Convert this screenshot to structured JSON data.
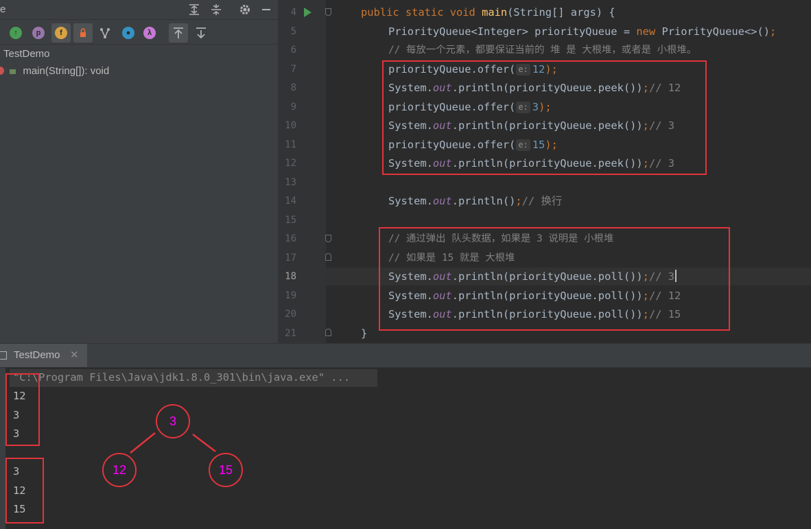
{
  "structure": {
    "title": "e",
    "header_icons": [
      "expand-all-icon",
      "collapse-all-icon",
      "gear-icon",
      "minimize-icon"
    ],
    "toolbar_icons": [
      "show-inherited-icon",
      "show-properties-icon",
      "show-fields-icon",
      "show-non-public-icon",
      "show-hierarchy-icon",
      "show-anonymous-icon",
      "show-lambdas-icon",
      "autoscroll-to-source-icon",
      "autoscroll-from-source-icon"
    ],
    "toolbar_labels": [
      "p",
      "f",
      "λ"
    ],
    "tree": {
      "class_name": "TestDemo",
      "method": "main(String[]): void"
    }
  },
  "editor": {
    "line_numbers": [
      "4",
      "5",
      "6",
      "7",
      "8",
      "9",
      "10",
      "11",
      "12",
      "13",
      "14",
      "15",
      "16",
      "17",
      "18",
      "19",
      "20",
      "21"
    ],
    "current_line": "18",
    "code": {
      "l4_kw": "public static void ",
      "l4_fn": "main",
      "l4_rest": "(String[] args) {",
      "l5_a": "PriorityQueue<Integer> priorityQueue = ",
      "l5_kw": "new ",
      "l5_b": "PriorityQueue<>()",
      "l5_semi": ";",
      "l6": "// 每放一个元素，都要保证当前的 堆 是 大根堆，或者是 小根堆。",
      "offer": "priorityQueue.offer(",
      "hint_e": "e:",
      "v12": "12",
      "v3": "3",
      "v15": "15",
      "close_semi": ");",
      "sys": "System.",
      "out": "out",
      "peek": ".println(priorityQueue.peek())",
      "poll": ".println(priorityQueue.poll())",
      "empty_println": ".println()",
      "semi": ";",
      "c12": "// 12",
      "c3": "// 3",
      "c15": "// 15",
      "c_newline": "// 换行",
      "l16": "// 通过弹出 队头数据，如果是 3 说明是 小根堆",
      "l17": "// 如果是 15 就是 大根堆",
      "brace": "}"
    }
  },
  "run": {
    "tab_label": "TestDemo",
    "command": "\"C:\\Program Files\\Java\\jdk1.8.0_301\\bin\\java.exe\" ...",
    "output_peek": [
      "12",
      "3",
      "3"
    ],
    "output_poll": [
      "3",
      "12",
      "15"
    ]
  },
  "heap_diagram": {
    "root": "3",
    "left": "12",
    "right": "15"
  }
}
